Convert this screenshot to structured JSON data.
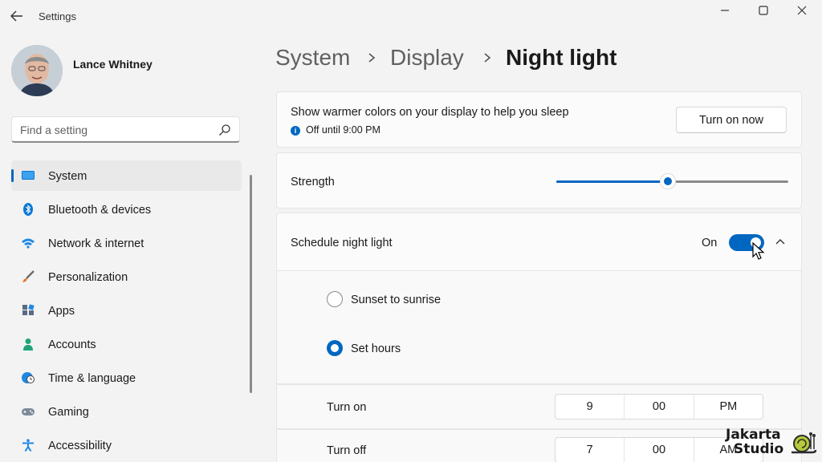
{
  "window": {
    "title": "Settings",
    "icons": {
      "back": "arrow-left-icon",
      "minimize": "minimize-icon",
      "maximize": "maximize-icon",
      "close": "close-icon"
    }
  },
  "profile": {
    "name": "Lance Whitney"
  },
  "search": {
    "placeholder": "Find a setting",
    "icon": "search-icon"
  },
  "sidebar": {
    "items": [
      {
        "label": "System",
        "icon": "monitor-icon",
        "active": true
      },
      {
        "label": "Bluetooth & devices",
        "icon": "bluetooth-icon"
      },
      {
        "label": "Network & internet",
        "icon": "wifi-icon"
      },
      {
        "label": "Personalization",
        "icon": "brush-icon"
      },
      {
        "label": "Apps",
        "icon": "apps-icon"
      },
      {
        "label": "Accounts",
        "icon": "person-icon"
      },
      {
        "label": "Time & language",
        "icon": "globe-clock-icon"
      },
      {
        "label": "Gaming",
        "icon": "gamepad-icon"
      },
      {
        "label": "Accessibility",
        "icon": "accessibility-icon"
      }
    ]
  },
  "breadcrumb": {
    "level1": "System",
    "level2": "Display",
    "current": "Night light"
  },
  "night_light": {
    "description": "Show warmer colors on your display to help you sleep",
    "status": "Off until 9:00 PM",
    "turn_on_button": "Turn on now",
    "strength_label": "Strength",
    "strength_value": 0.48,
    "schedule_label": "Schedule night light",
    "schedule_state": "On",
    "schedule_on": true,
    "options": [
      {
        "label": "Sunset to sunrise",
        "selected": false
      },
      {
        "label": "Set hours",
        "selected": true
      }
    ],
    "turn_on": {
      "label": "Turn on",
      "hour": "9",
      "minute": "00",
      "period": "PM"
    },
    "turn_off": {
      "label": "Turn off",
      "hour": "7",
      "minute": "00",
      "period": "AM"
    }
  },
  "watermark": {
    "line1": "Jakarta",
    "line2": "Studio"
  },
  "colors": {
    "accent": "#0067c0",
    "background": "#f3f3f3",
    "card": "#fbfbfb"
  }
}
